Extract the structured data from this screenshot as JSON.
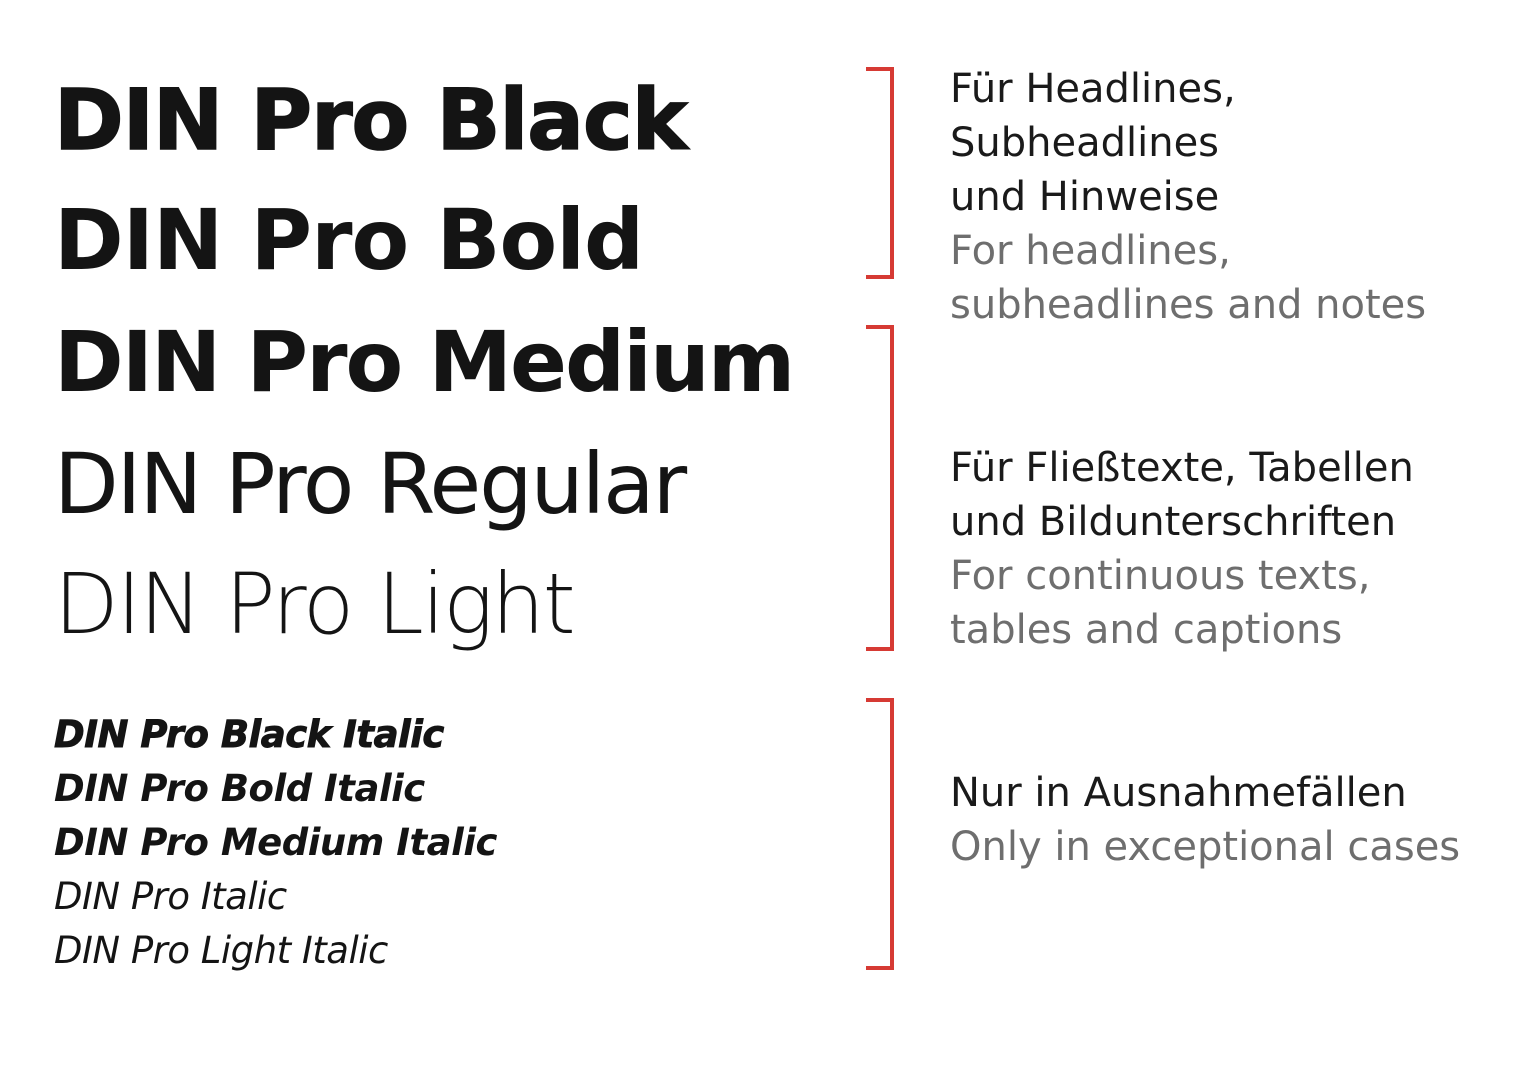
{
  "weights": {
    "black": "DIN Pro Black",
    "bold": "DIN Pro Bold",
    "medium": "DIN Pro Medium",
    "regular": "DIN Pro Regular",
    "light": "DIN Pro Light"
  },
  "italics": {
    "black_italic": "DIN Pro Black Italic",
    "bold_italic": "DIN Pro Bold Italic",
    "medium_italic": "DIN Pro Medium Italic",
    "italic": "DIN Pro Italic",
    "light_italic": "DIN Pro Light Italic"
  },
  "notes": {
    "headlines": {
      "de": [
        "Für Headlines,",
        "Subheadlines",
        "und Hinweise"
      ],
      "en": [
        "For headlines,",
        "subheadlines and notes"
      ]
    },
    "body": {
      "de": [
        "Für Fließtexte, Tabellen",
        "und Bildunterschriften"
      ],
      "en": [
        "For continuous texts,",
        "tables and captions"
      ]
    },
    "exceptional": {
      "de": [
        "Nur in Ausnahmefällen"
      ],
      "en": [
        "Only in exceptional cases"
      ]
    }
  },
  "colors": {
    "bracket": "#d63a34",
    "text_primary": "#1a1a1a",
    "text_secondary": "#6e6e6e"
  }
}
